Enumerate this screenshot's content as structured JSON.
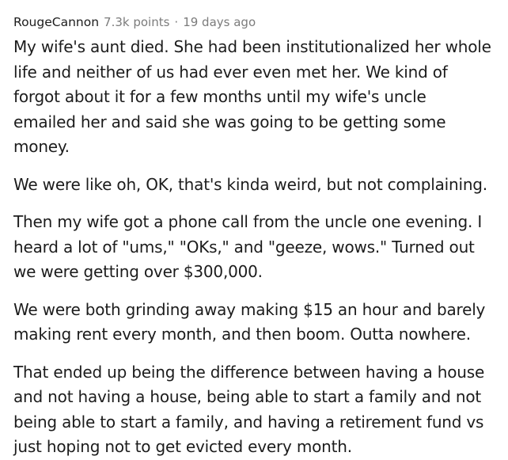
{
  "comment": {
    "author": "RougeCannon",
    "points": "7.3k points",
    "separator": "·",
    "time": "19 days ago",
    "paragraphs": [
      "My wife's aunt died. She had been institutionalized her whole life and neither of us had ever even met her. We kind of forgot about it for a few months until my wife's uncle emailed her and said she was going to be getting some money.",
      "We were like oh, OK, that's kinda weird, but not complaining.",
      "Then my wife got a phone call from the uncle one evening. I heard a lot of \"ums,\" \"OKs,\" and \"geeze, wows.\" Turned out we were getting over $300,000.",
      "We were both grinding away making $15 an hour and barely making rent every month, and then boom. Outta nowhere.",
      "That ended up being the difference between having a house and not having a house, being able to start a family and not being able to start a family, and having a retirement fund vs just hoping not to get evicted every month."
    ]
  }
}
